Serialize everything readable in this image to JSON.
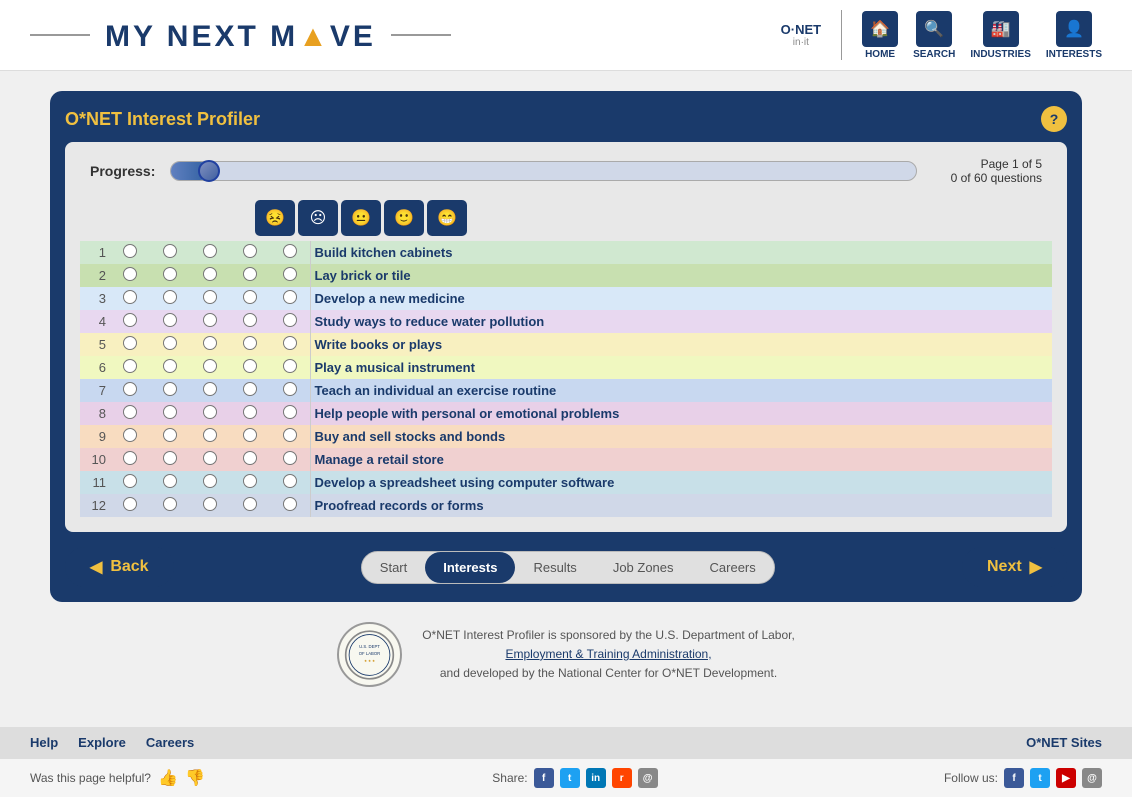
{
  "header": {
    "logo_my": "MY",
    "logo_next": "NEXT",
    "logo_move": "MOVE",
    "onet_name": "O·NET",
    "onet_sub": "in·it",
    "nav": [
      {
        "label": "HOME",
        "icon": "🏠"
      },
      {
        "label": "SEARCH",
        "icon": "🔍"
      },
      {
        "label": "INDUSTRIES",
        "icon": "🏭"
      },
      {
        "label": "INTERESTS",
        "icon": "👤"
      }
    ]
  },
  "profiler": {
    "title": "O*NET Interest Profiler",
    "help_label": "?",
    "progress_label": "Progress:",
    "page_info_line1": "Page 1 of 5",
    "page_info_line2": "0 of 60 questions"
  },
  "emojis": [
    "😣",
    "☹",
    "😐",
    "🙂",
    "😁"
  ],
  "questions": [
    {
      "num": 1,
      "text": "Build kitchen cabinets",
      "color_class": "row-0"
    },
    {
      "num": 2,
      "text": "Lay brick or tile",
      "color_class": "row-1"
    },
    {
      "num": 3,
      "text": "Develop a new medicine",
      "color_class": "row-2"
    },
    {
      "num": 4,
      "text": "Study ways to reduce water pollution",
      "color_class": "row-3"
    },
    {
      "num": 5,
      "text": "Write books or plays",
      "color_class": "row-4"
    },
    {
      "num": 6,
      "text": "Play a musical instrument",
      "color_class": "row-5"
    },
    {
      "num": 7,
      "text": "Teach an individual an exercise routine",
      "color_class": "row-6"
    },
    {
      "num": 8,
      "text": "Help people with personal or emotional problems",
      "color_class": "row-7"
    },
    {
      "num": 9,
      "text": "Buy and sell stocks and bonds",
      "color_class": "row-8"
    },
    {
      "num": 10,
      "text": "Manage a retail store",
      "color_class": "row-9"
    },
    {
      "num": 11,
      "text": "Develop a spreadsheet using computer software",
      "color_class": "row-10"
    },
    {
      "num": 12,
      "text": "Proofread records or forms",
      "color_class": "row-11"
    }
  ],
  "nav_steps": [
    {
      "label": "Start",
      "active": false
    },
    {
      "label": "Interests",
      "active": true
    },
    {
      "label": "Results",
      "active": false
    },
    {
      "label": "Job Zones",
      "active": false
    },
    {
      "label": "Careers",
      "active": false
    }
  ],
  "back_label": "Back",
  "next_label": "Next",
  "sponsor": {
    "text1": "O*NET Interest Profiler is sponsored by the U.S. Department of Labor,",
    "link_text": "Employment & Training Administration,",
    "text2": "and developed by the National Center for O*NET Development."
  },
  "footer": {
    "links": [
      "Help",
      "Explore",
      "Careers"
    ],
    "onet_sites": "O*NET Sites"
  },
  "social": {
    "helpful_label": "Was this page helpful?",
    "share_label": "Share:",
    "follow_label": "Follow us:"
  }
}
